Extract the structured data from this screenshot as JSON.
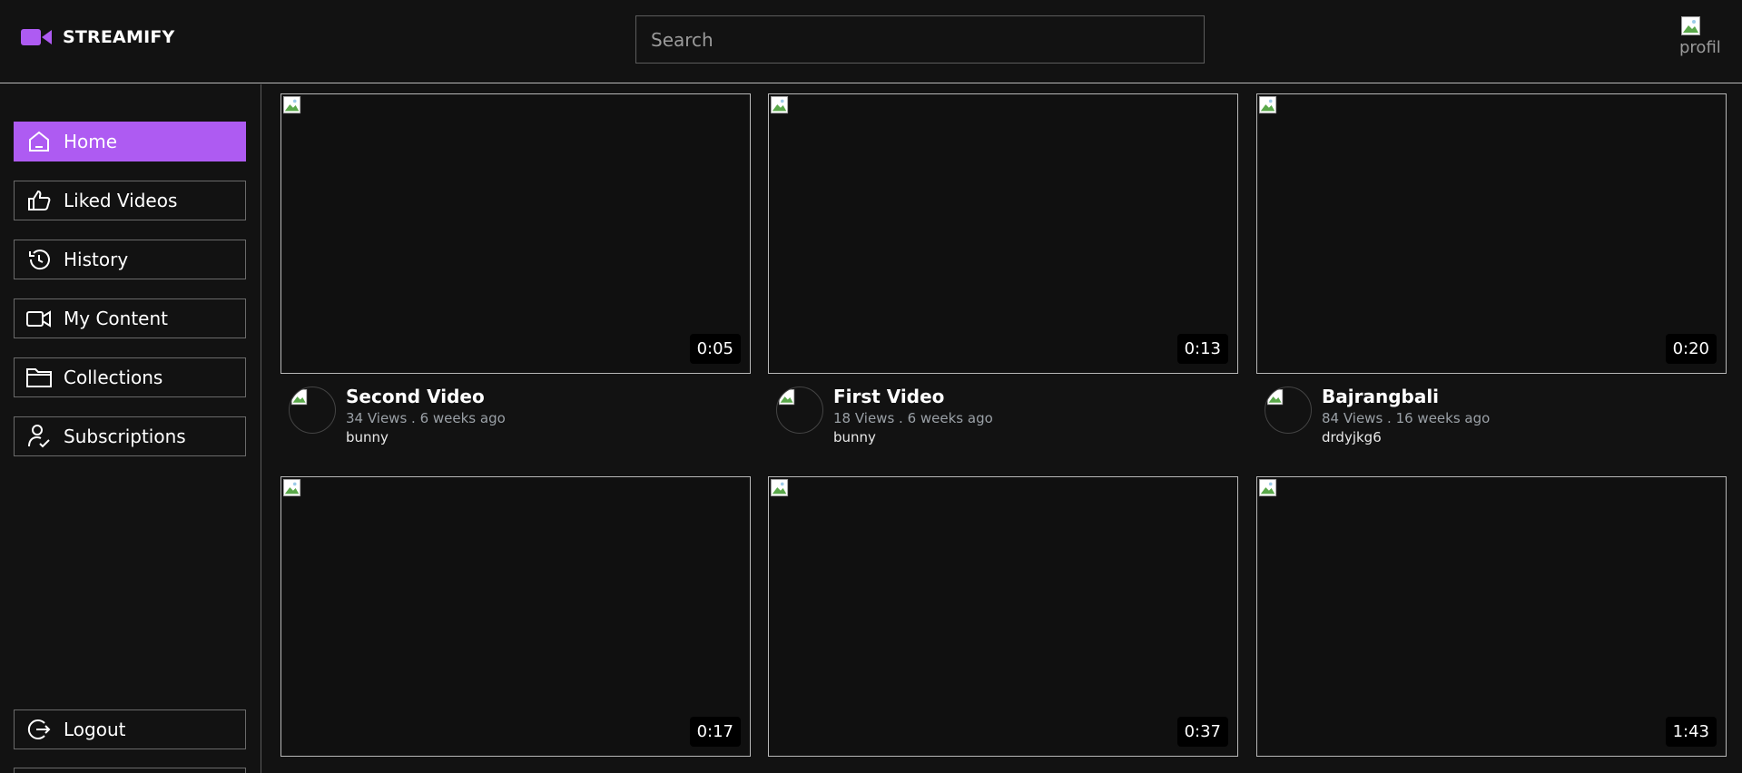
{
  "app": {
    "brand": "STREAMIFY",
    "accent_color": "#ae5bf2"
  },
  "header": {
    "search_placeholder": "Search",
    "profile_alt": "profil"
  },
  "sidebar": {
    "items": [
      {
        "label": "Home",
        "icon": "home-icon",
        "active": true
      },
      {
        "label": "Liked Videos",
        "icon": "thumbs-up-icon"
      },
      {
        "label": "History",
        "icon": "history-icon"
      },
      {
        "label": "My Content",
        "icon": "video-camera-icon"
      },
      {
        "label": "Collections",
        "icon": "folder-icon"
      },
      {
        "label": "Subscriptions",
        "icon": "user-check-icon"
      }
    ],
    "logout": {
      "label": "Logout",
      "icon": "logout-icon"
    }
  },
  "videos": [
    {
      "title": "Second Video",
      "views": "34 Views . 6 weeks ago",
      "channel": "bunny",
      "duration": "0:05"
    },
    {
      "title": "First Video",
      "views": "18 Views . 6 weeks ago",
      "channel": "bunny",
      "duration": "0:13"
    },
    {
      "title": "Bajrangbali",
      "views": "84 Views . 16 weeks ago",
      "channel": "drdyjkg6",
      "duration": "0:20"
    },
    {
      "duration": "0:17"
    },
    {
      "duration": "0:37"
    },
    {
      "duration": "1:43"
    }
  ]
}
